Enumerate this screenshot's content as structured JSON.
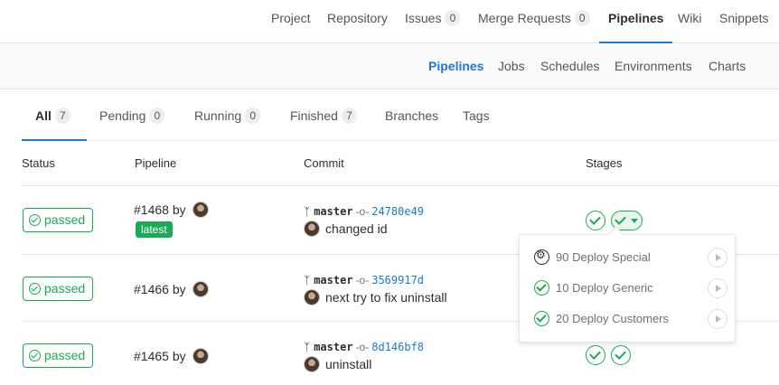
{
  "top_nav": {
    "items": [
      {
        "label": "Project"
      },
      {
        "label": "Repository"
      },
      {
        "label": "Issues",
        "count": "0"
      },
      {
        "label": "Merge Requests",
        "count": "0"
      },
      {
        "label": "Pipelines",
        "active": true
      },
      {
        "label": "Wiki"
      },
      {
        "label": "Snippets"
      }
    ]
  },
  "sub_nav": {
    "items": [
      {
        "label": "Pipelines",
        "active": true
      },
      {
        "label": "Jobs"
      },
      {
        "label": "Schedules"
      },
      {
        "label": "Environments"
      },
      {
        "label": "Charts"
      }
    ]
  },
  "scope_tabs": [
    {
      "label": "All",
      "count": "7",
      "active": true
    },
    {
      "label": "Pending",
      "count": "0"
    },
    {
      "label": "Running",
      "count": "0"
    },
    {
      "label": "Finished",
      "count": "7"
    },
    {
      "label": "Branches"
    },
    {
      "label": "Tags"
    }
  ],
  "table": {
    "headers": [
      "Status",
      "Pipeline",
      "Commit",
      "Stages"
    ],
    "rows": [
      {
        "status": "passed",
        "pipeline": "#1468 by",
        "badge": "latest",
        "ref": "master",
        "sha": "24780e49",
        "message": "changed id"
      },
      {
        "status": "passed",
        "pipeline": "#1466 by",
        "ref": "master",
        "sha": "3569917d",
        "message": "next try to fix uninstall"
      },
      {
        "status": "passed",
        "pipeline": "#1465 by",
        "ref": "master",
        "sha": "8d146bf8",
        "message": "uninstall"
      }
    ]
  },
  "stage_dropdown": {
    "jobs": [
      {
        "name": "90 Deploy Special",
        "icon": "manual-gear-icon"
      },
      {
        "name": "10 Deploy Generic",
        "icon": "success-check-icon"
      },
      {
        "name": "20 Deploy Customers",
        "icon": "success-check-icon"
      }
    ]
  },
  "colors": {
    "success": "#1aaa55",
    "link": "#1f78d1",
    "border": "#e5e5e5"
  }
}
